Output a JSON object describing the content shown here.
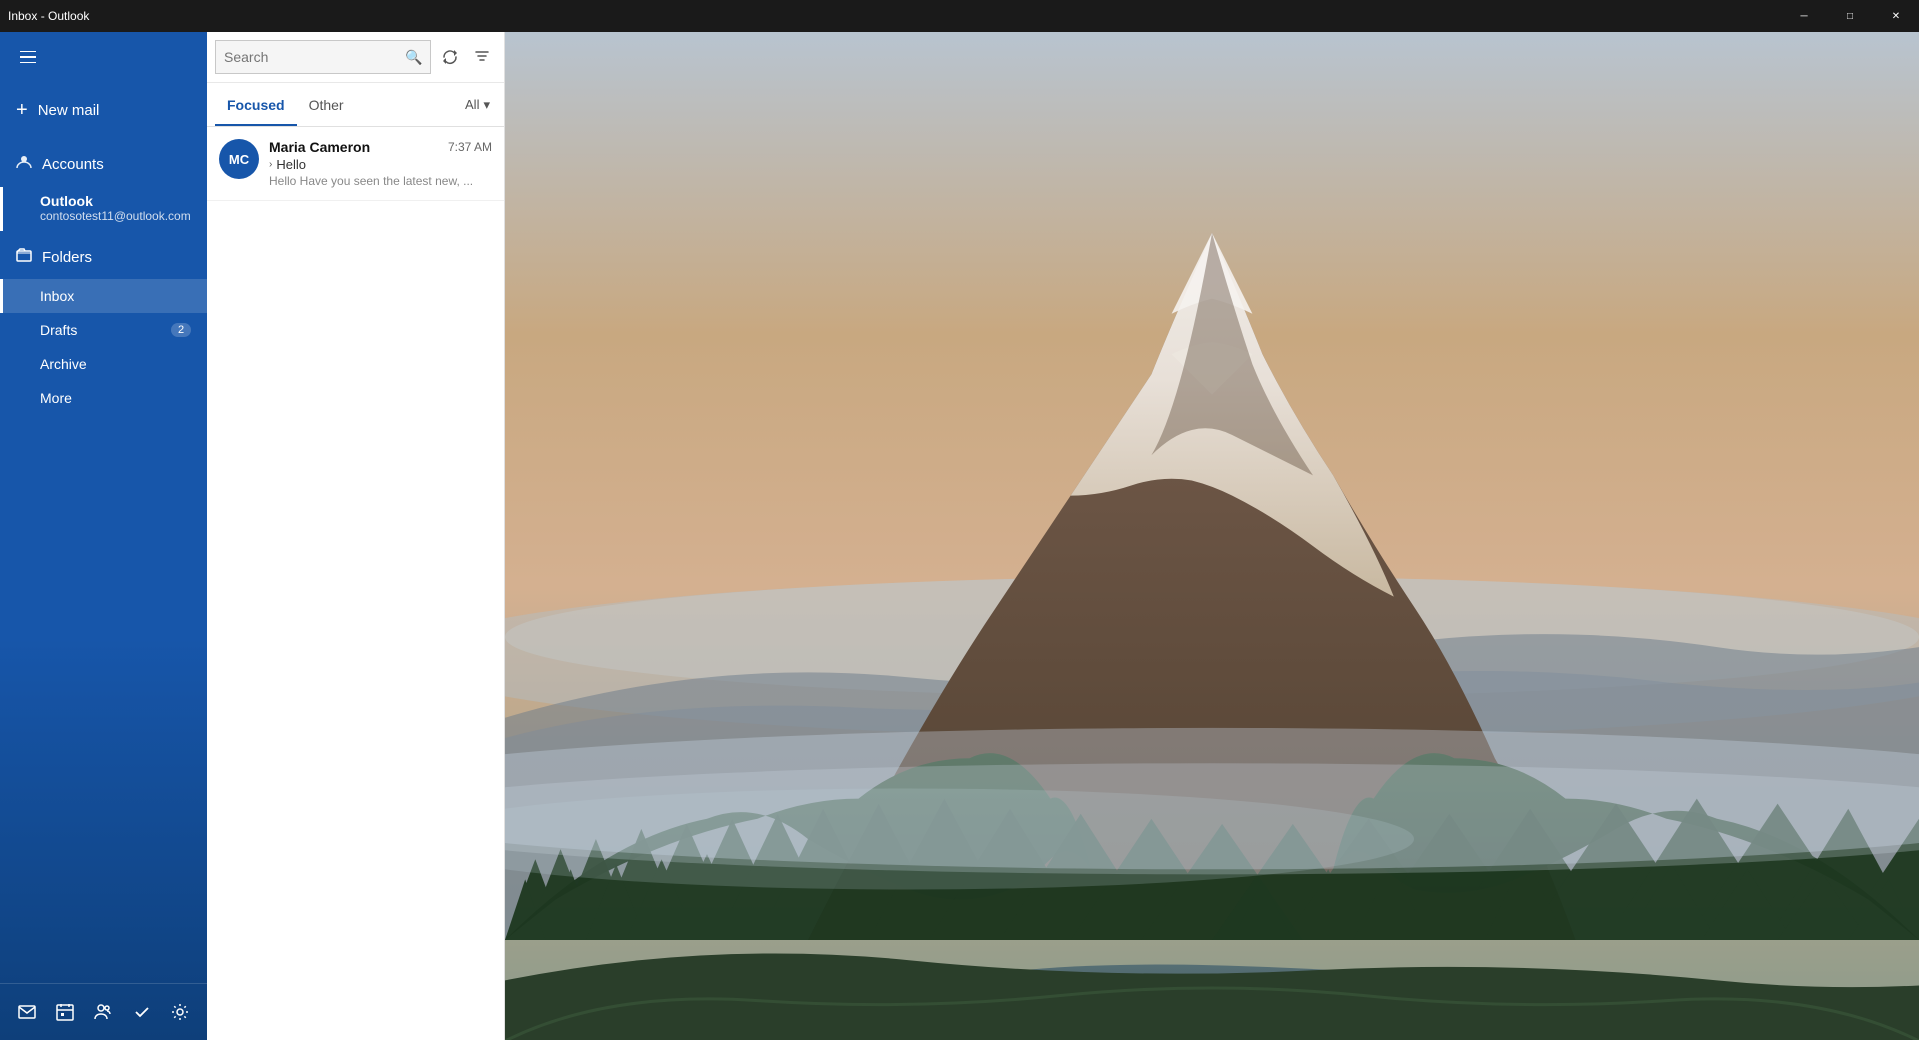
{
  "titleBar": {
    "title": "Inbox - Outlook",
    "minimize": "─",
    "restore": "□",
    "close": "✕"
  },
  "sidebar": {
    "hamburger_label": "Menu",
    "newMail": {
      "label": "New mail",
      "icon": "+"
    },
    "accounts": {
      "sectionLabel": "Accounts",
      "sectionIcon": "👤",
      "items": [
        {
          "name": "Outlook",
          "email": "contosotest11@outlook.com",
          "active": true
        }
      ]
    },
    "folders": {
      "sectionLabel": "Folders",
      "sectionIcon": "📁",
      "items": [
        {
          "label": "Inbox",
          "badge": "",
          "active": true
        },
        {
          "label": "Drafts",
          "badge": "2",
          "active": false
        },
        {
          "label": "Archive",
          "badge": "",
          "active": false
        },
        {
          "label": "More",
          "badge": "",
          "active": false
        }
      ]
    },
    "bottomIcons": [
      {
        "name": "mail-icon",
        "symbol": "✉"
      },
      {
        "name": "calendar-icon",
        "symbol": "▦"
      },
      {
        "name": "people-icon",
        "symbol": "👥"
      },
      {
        "name": "tasks-icon",
        "symbol": "✓"
      },
      {
        "name": "settings-icon",
        "symbol": "⚙"
      }
    ]
  },
  "mailPanel": {
    "search": {
      "placeholder": "Search",
      "value": ""
    },
    "tabs": [
      {
        "label": "Focused",
        "active": true
      },
      {
        "label": "Other",
        "active": false
      }
    ],
    "filterLabel": "All",
    "emails": [
      {
        "sender": "Maria Cameron",
        "initials": "MC",
        "avatarColor": "#2c5f9e",
        "time": "7:37 AM",
        "subject": "Hello",
        "preview": "Hello Have you seen the latest new, ...",
        "hasChevron": true
      }
    ]
  },
  "colors": {
    "sidebarBg": "#1756aa",
    "accentBlue": "#1756aa",
    "white": "#ffffff"
  }
}
